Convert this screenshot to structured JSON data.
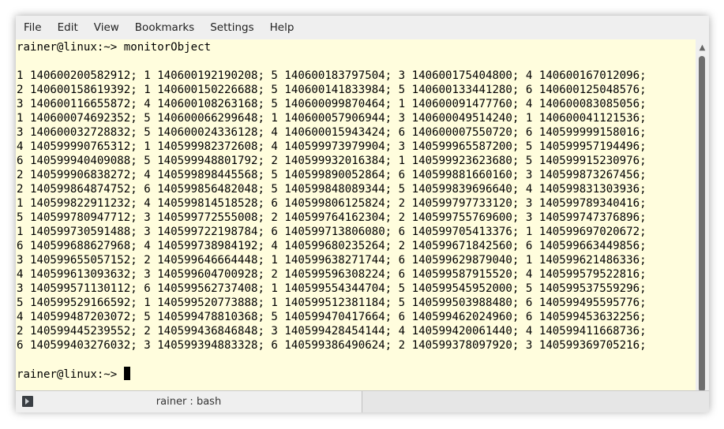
{
  "menubar": {
    "items": [
      "File",
      "Edit",
      "View",
      "Bookmarks",
      "Settings",
      "Help"
    ]
  },
  "terminal": {
    "lines": [
      "rainer@linux:~> monitorObject",
      "",
      "1 140600200582912; 1 140600192190208; 5 140600183797504; 3 140600175404800; 4 140600167012096;",
      "2 140600158619392; 1 140600150226688; 5 140600141833984; 5 140600133441280; 6 140600125048576;",
      "3 140600116655872; 4 140600108263168; 5 140600099870464; 1 140600091477760; 4 140600083085056;",
      "1 140600074692352; 5 140600066299648; 1 140600057906944; 3 140600049514240; 1 140600041121536;",
      "3 140600032728832; 5 140600024336128; 4 140600015943424; 6 140600007550720; 6 140599999158016;",
      "4 140599990765312; 1 140599982372608; 4 140599973979904; 3 140599965587200; 5 140599957194496;",
      "6 140599940409088; 5 140599948801792; 2 140599932016384; 1 140599923623680; 5 140599915230976;",
      "2 140599906838272; 4 140599898445568; 5 140599890052864; 6 140599881660160; 3 140599873267456;",
      "2 140599864874752; 6 140599856482048; 5 140599848089344; 5 140599839696640; 4 140599831303936;",
      "1 140599822911232; 4 140599814518528; 6 140599806125824; 2 140599797733120; 3 140599789340416;",
      "5 140599780947712; 3 140599772555008; 2 140599764162304; 2 140599755769600; 3 140599747376896;",
      "1 140599730591488; 3 140599722198784; 6 140599713806080; 6 140599705413376; 1 140599697020672;",
      "6 140599688627968; 4 140599738984192; 4 140599680235264; 2 140599671842560; 6 140599663449856;",
      "3 140599655057152; 2 140599646664448; 1 140599638271744; 6 140599629879040; 1 140599621486336;",
      "4 140599613093632; 3 140599604700928; 2 140599596308224; 6 140599587915520; 4 140599579522816;",
      "3 140599571130112; 6 140599562737408; 1 140599554344704; 5 140599545952000; 5 140599537559296;",
      "5 140599529166592; 1 140599520773888; 1 140599512381184; 5 140599503988480; 6 140599495595776;",
      "4 140599487203072; 5 140599478810368; 5 140599470417664; 6 140599462024960; 6 140599453632256;",
      "2 140599445239552; 2 140599436846848; 3 140599428454144; 4 140599420061440; 4 140599411668736;",
      "6 140599403276032; 3 140599394883328; 6 140599386490624; 2 140599378097920; 3 140599369705216;",
      ""
    ],
    "prompt": "rainer@linux:~> "
  },
  "tab": {
    "label": "rainer : bash",
    "icon": "terminal-icon"
  },
  "colors": {
    "terminal_bg": "#fffddd",
    "chrome": "#efefef"
  }
}
